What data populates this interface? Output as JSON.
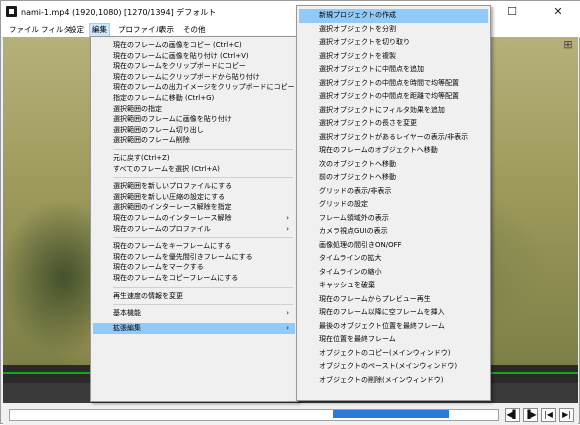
{
  "window": {
    "title": "nami-1.mp4 (1920,1080)  [1270/1394]  デフォルト",
    "minimize": "─",
    "maximize": "☐",
    "close": "✕"
  },
  "menubar": [
    "ファイル",
    "フィルタ",
    "設定",
    "編集",
    "プロファイル",
    "表示",
    "その他"
  ],
  "edit_menu": {
    "groups": [
      [
        "現在のフレームの画像をコピー (Ctrl+C)",
        "現在のフレームに画像を貼り付け (Ctrl+V)",
        "現在のフレームをクリップボードにコピー",
        "現在のフレームにクリップボードから貼り付け",
        "現在のフレームの出力イメージをクリップボードにコピー",
        "指定のフレームに移動 (Ctrl+G)",
        "選択範囲の指定",
        "選択範囲のフレームに画像を貼り付け",
        "選択範囲のフレーム切り出し",
        "選択範囲のフレーム削除"
      ],
      [
        "元に戻す(Ctrl+Z)",
        "すべてのフレームを選択 (Ctrl+A)"
      ],
      [
        "選択範囲を新しいプロファイルにする",
        "選択範囲を新しい圧縮の設定にする",
        "選択範囲のインターレース解除を指定",
        "現在のフレームのインターレース解除",
        "現在のフレームのプロファイル"
      ],
      [
        "現在のフレームをキーフレームにする",
        "現在のフレームを優先間引きフレームにする",
        "現在のフレームをマークする",
        "現在のフレームをコピーフレームにする"
      ],
      [
        "再生速度の情報を変更"
      ],
      [
        "基本機能",
        "拡張編集"
      ]
    ]
  },
  "ext_submenu": [
    "新規プロジェクトの作成",
    "選択オブジェクトを分割",
    "選択オブジェクトを切り取り",
    "選択オブジェクトを複製",
    "選択オブジェクトに中間点を追加",
    "選択オブジェクトの中間点を時間で均等配置",
    "選択オブジェクトの中間点を距離で均等配置",
    "選択オブジェクトにフィルタ効果を追加",
    "選択オブジェクトの長さを変更",
    "選択オブジェクトがあるレイヤーの表示/非表示",
    "現在のフレームのオブジェクトへ移動",
    "次のオブジェクトへ移動",
    "前のオブジェクトへ移動",
    "グリッドの表示/非表示",
    "グリッドの設定",
    "フレーム領域外の表示",
    "カメラ視点GUIの表示",
    "画像処理の間引きON/OFF",
    "タイムラインの拡大",
    "タイムラインの縮小",
    "キャッシュを破棄",
    "現在のフレームからプレビュー再生",
    "現在のフレーム以降に空フレームを挿入",
    "最後のオブジェクト位置を最終フレーム",
    "現在位置を最終フレーム",
    "オブジェクトのコピー(メインウィンドウ)",
    "オブジェクトのペースト(メインウィンドウ)",
    "オブジェクトの削除(メインウィンドウ)"
  ],
  "timeline": {
    "seek_fraction": 0.91,
    "buttons": [
      "◀▌",
      "▐▶",
      "|◀",
      "▶|"
    ]
  },
  "side_icon": "⊞"
}
